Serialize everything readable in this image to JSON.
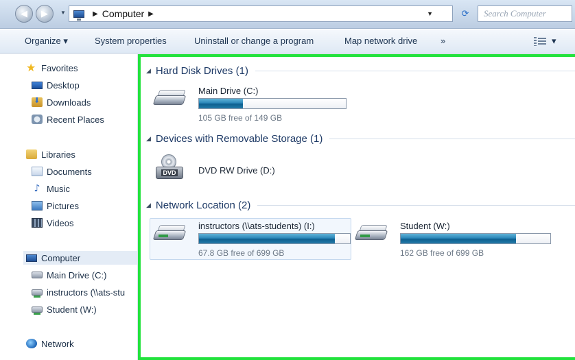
{
  "address_bar": {
    "location": "Computer",
    "search_placeholder": "Search Computer"
  },
  "toolbar": {
    "organize": "Organize ▾",
    "system_properties": "System properties",
    "uninstall": "Uninstall or change a program",
    "map_network_drive": "Map network drive",
    "more": "»",
    "views_dropdown": "▾"
  },
  "sidebar": {
    "favorites": "Favorites",
    "desktop": "Desktop",
    "downloads": "Downloads",
    "recent_places": "Recent Places",
    "libraries": "Libraries",
    "documents": "Documents",
    "music": "Music",
    "pictures": "Pictures",
    "videos": "Videos",
    "computer": "Computer",
    "main_drive": "Main Drive (C:)",
    "instructors": "instructors (\\\\ats-stu",
    "student": "Student (W:)",
    "network": "Network"
  },
  "groups": {
    "hard_disk": "Hard Disk Drives (1)",
    "removable": "Devices with Removable Storage (1)",
    "network": "Network Location (2)"
  },
  "drives": {
    "main": {
      "name": "Main Drive (C:)",
      "free_text": "105 GB free of 149 GB",
      "used_fraction": 0.3
    },
    "dvd": {
      "name": "DVD RW Drive (D:)",
      "badge": "DVD"
    },
    "instructors": {
      "name": "instructors (\\\\ats-students) (I:)",
      "free_text": "67.8 GB free of 699 GB",
      "used_fraction": 0.9
    },
    "student": {
      "name": "Student (W:)",
      "free_text": "162 GB free of 699 GB",
      "used_fraction": 0.77
    }
  },
  "colors": {
    "highlight_border": "#22e23c",
    "bar_fill": "#1a72a4"
  }
}
